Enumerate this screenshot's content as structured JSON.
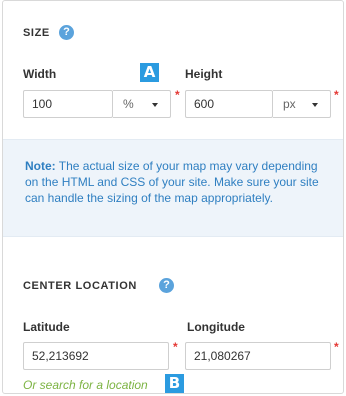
{
  "size": {
    "title": "SIZE",
    "help_glyph": "?",
    "width_label": "Width",
    "width_value": "100",
    "width_unit": "%",
    "height_label": "Height",
    "height_value": "600",
    "height_unit": "px",
    "required_mark": "*"
  },
  "note": {
    "bold_label": "Note:",
    "text": " The actual size of your map may vary depending on the HTML and CSS of your site. Make sure your site can handle the sizing of the map appropriately."
  },
  "center": {
    "title": "CENTER LOCATION",
    "help_glyph": "?",
    "latitude_label": "Latitude",
    "latitude_value": "52,213692",
    "longitude_label": "Longitude",
    "longitude_value": "21,080267",
    "required_mark": "*",
    "search_link": "Or search for a location"
  },
  "annotations": {
    "a": "A",
    "b": "B"
  },
  "colors": {
    "accent_blue": "#2b9be0",
    "note_bg": "#eef4fa",
    "note_text": "#2f7fc1",
    "required_red": "#e53935",
    "link_green": "#7cb342"
  }
}
